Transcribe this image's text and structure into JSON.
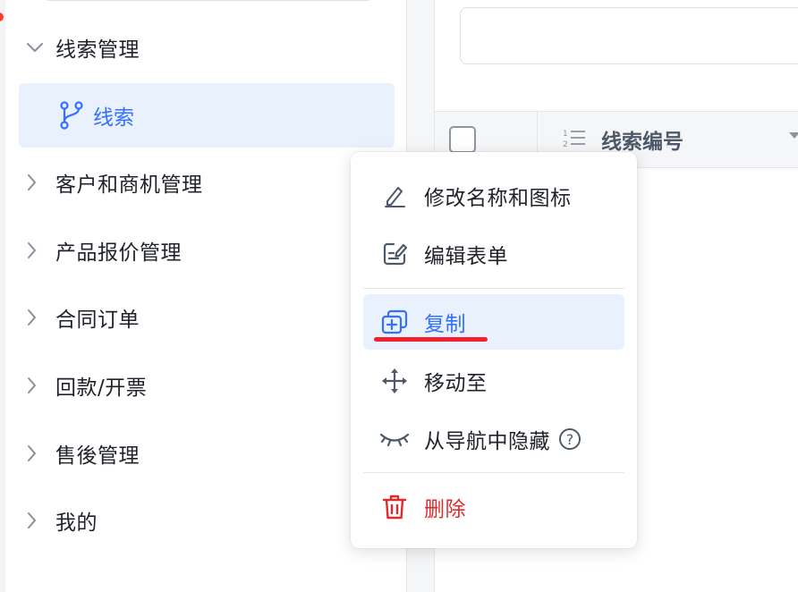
{
  "sidebar": {
    "expanded_group": {
      "label": "线索管理"
    },
    "active_item": {
      "label": "线索",
      "icon": "git-branch-icon",
      "color": "#3370ff"
    },
    "groups": [
      {
        "label": "客户和商机管理"
      },
      {
        "label": "产品报价管理"
      },
      {
        "label": "合同订单"
      },
      {
        "label": "回款/开票"
      },
      {
        "label": "售後管理"
      },
      {
        "label": "我的"
      }
    ]
  },
  "table": {
    "column_title": "线索编号",
    "column_icon": "ordered-list-icon"
  },
  "context_menu": {
    "items": [
      {
        "label": "修改名称和图标",
        "icon": "pen-icon"
      },
      {
        "label": "编辑表单",
        "icon": "edit-form-icon"
      },
      {
        "label": "复制",
        "icon": "copy-icon",
        "active": true
      },
      {
        "label": "移动至",
        "icon": "move-icon"
      },
      {
        "label": "从导航中隐藏",
        "icon": "eye-closed-icon",
        "help": "?"
      },
      {
        "label": "删除",
        "icon": "trash-icon",
        "danger": true
      }
    ]
  },
  "colors": {
    "accent": "#3370ff",
    "active_bg": "#e9f1fd",
    "danger": "#e02b2b",
    "annotation": "#f2222f"
  }
}
